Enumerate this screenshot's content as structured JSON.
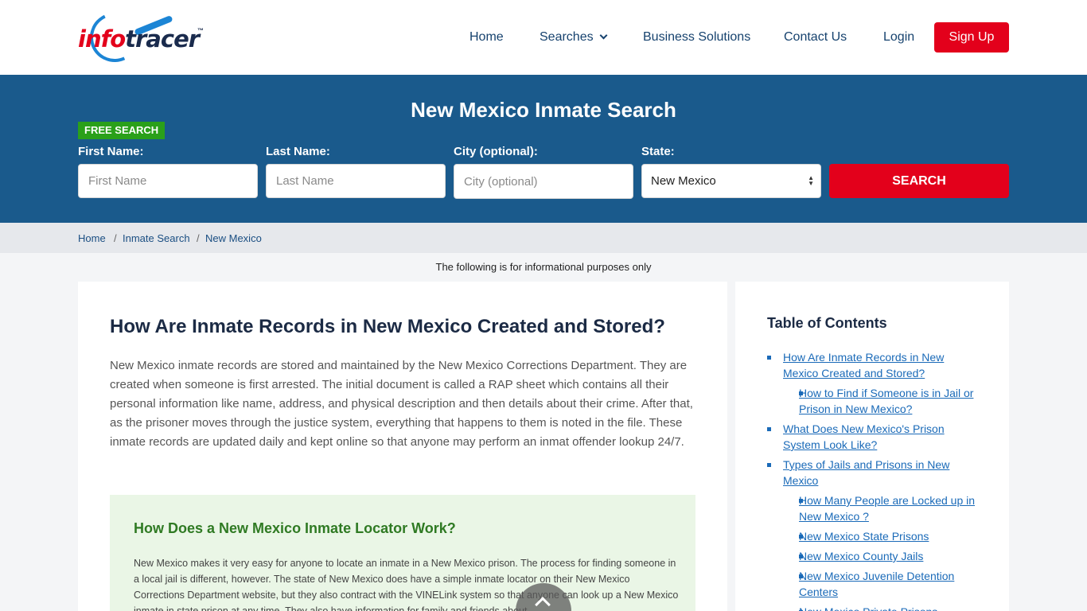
{
  "brand": {
    "name_part1": "info",
    "name_part2": "tracer",
    "tm": "™"
  },
  "nav": {
    "home": "Home",
    "searches": "Searches",
    "business": "Business Solutions",
    "contact": "Contact Us",
    "login": "Login",
    "signup": "Sign Up"
  },
  "hero": {
    "title": "New Mexico Inmate Search",
    "badge": "FREE SEARCH",
    "first_label": "First Name:",
    "first_placeholder": "First Name",
    "last_label": "Last Name:",
    "last_placeholder": "Last Name",
    "city_label": "City (optional):",
    "city_placeholder": "City (optional)",
    "state_label": "State:",
    "state_value": "New Mexico",
    "search_button": "SEARCH"
  },
  "breadcrumb": [
    "Home",
    "Inmate Search",
    "New Mexico"
  ],
  "note": "The following is for informational purposes only",
  "main": {
    "heading": "How Are Inmate Records in New Mexico Created and Stored?",
    "paragraph": "New Mexico inmate records are stored and maintained by the New Mexico Corrections Department. They are created when someone is first arrested. The initial document is called a RAP sheet which contains all their personal information like name, address, and physical description and then details about their crime. After that, as the prisoner moves through the justice system, everything that happens to them is noted in the file. These inmate records are updated daily and kept online so that anyone may perform an inmat offender lookup 24/7.",
    "box_heading": "How Does a New Mexico Inmate Locator Work?",
    "box_paragraph": "New Mexico makes it very easy for anyone to locate an inmate in a New Mexico prison. The process for finding someone in a local jail is different, however. The state of New Mexico does have a simple inmate locator on their New Mexico Corrections Department website, but they also contract with the VINELink system so that anyone can look up a New Mexico inmate in state prison at any time. They also have information for family and friends about"
  },
  "toc": {
    "title": "Table of Contents",
    "items": [
      "How Are Inmate Records in New Mexico Created and Stored?",
      "How to Find if Someone is in Jail or Prison in New Mexico?",
      "What Does New Mexico's Prison System Look Like?",
      "Types of Jails and Prisons in New Mexico",
      "How Many People are Locked up in New Mexico ?",
      "New Mexico State Prisons",
      "New Mexico County Jails",
      "New Mexico Juvenile Detention Centers",
      "New Mexico Private Prisons"
    ]
  }
}
